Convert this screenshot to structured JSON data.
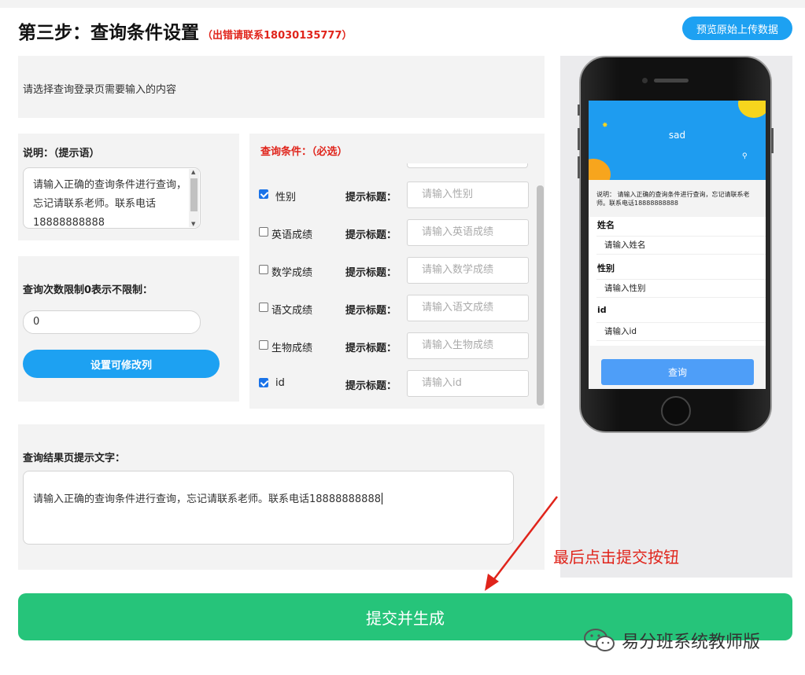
{
  "header": {
    "title": "第三步：查询条件设置",
    "warning": "（出错请联系18030135777）",
    "preview_button": "预览原始上传数据"
  },
  "intro": {
    "text": "请选择查询登录页需要输入的内容"
  },
  "description": {
    "label": "说明：（提示语）",
    "value": "请输入正确的查询条件进行查询，忘记请联系老师。联系电话18888888888"
  },
  "limit": {
    "label": "查询次数限制0表示不限制：",
    "value": "0",
    "set_button": "设置可修改列"
  },
  "conditions": {
    "header": "查询条件：（必选）",
    "hint_label": "提示标题：",
    "rows": [
      {
        "name": "性别",
        "checked": true,
        "placeholder": "请输入性别"
      },
      {
        "name": "英语成绩",
        "checked": false,
        "placeholder": "请输入英语成绩"
      },
      {
        "name": "数学成绩",
        "checked": false,
        "placeholder": "请输入数学成绩"
      },
      {
        "name": "语文成绩",
        "checked": false,
        "placeholder": "请输入语文成绩"
      },
      {
        "name": "生物成绩",
        "checked": false,
        "placeholder": "请输入生物成绩"
      },
      {
        "name": "id",
        "checked": true,
        "placeholder": "请输入id"
      }
    ]
  },
  "result": {
    "label": "查询结果页提示文字：",
    "value": "请输入正确的查询条件进行查询，忘记请联系老师。联系电话18888888888"
  },
  "phone_preview": {
    "title": "sad",
    "note": "说明：  请输入正确的查询条件进行查询，忘记请联系老师。联系电话18888888888",
    "fields": [
      {
        "label": "姓名",
        "placeholder": "请输入姓名"
      },
      {
        "label": "性别",
        "placeholder": "请输入性别"
      },
      {
        "label": "id",
        "placeholder": "请输入id"
      }
    ],
    "query_button": "查询"
  },
  "submit_button": "提交并生成",
  "annotation": "最后点击提交按钮",
  "watermark": "易分班系统教师版",
  "colors": {
    "primary_blue": "#1da1f2",
    "submit_green": "#26c47a",
    "warning_red": "#e0241b",
    "phone_header": "#1e9cf0"
  }
}
